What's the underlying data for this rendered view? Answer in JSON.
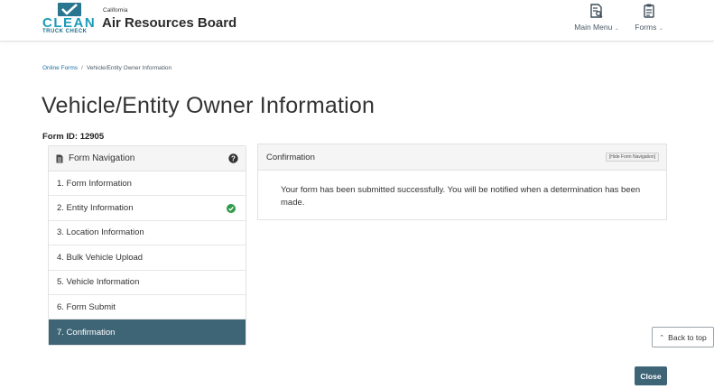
{
  "header": {
    "logo": {
      "clean": "CLEAN",
      "truck_check": "TRUCK CHECK"
    },
    "brand_small": "California",
    "brand_title": "Air Resources Board",
    "nav": [
      {
        "label": "Main Menu",
        "icon": "document-search-icon"
      },
      {
        "label": "Forms",
        "icon": "clipboard-icon"
      }
    ]
  },
  "breadcrumb": {
    "items": [
      "Online Forms",
      "Vehicle/Entity Owner Information"
    ],
    "separator": "/"
  },
  "page_title": "Vehicle/Entity Owner Information",
  "form_id": "Form ID: 12905",
  "form_nav": {
    "title": "Form Navigation",
    "items": [
      {
        "label": "1. Form Information"
      },
      {
        "label": "2. Entity Information",
        "complete": true
      },
      {
        "label": "3. Location Information"
      },
      {
        "label": "4. Bulk Vehicle Upload"
      },
      {
        "label": "5. Vehicle Information"
      },
      {
        "label": "6. Form Submit"
      },
      {
        "label": "7. Confirmation",
        "active": true
      }
    ]
  },
  "confirmation": {
    "title": "Confirmation",
    "hide_nav_label": "[Hide Form Navigation]",
    "message": "Your form has been submitted successfully. You will be notified when a determination has been made."
  },
  "buttons": {
    "back_to_top": "Back to top",
    "close": "Close"
  },
  "colors": {
    "accent": "#3e6576",
    "brand_teal": "#1c9bb8",
    "link": "#1c6ea4",
    "success": "#2e9a4a"
  }
}
